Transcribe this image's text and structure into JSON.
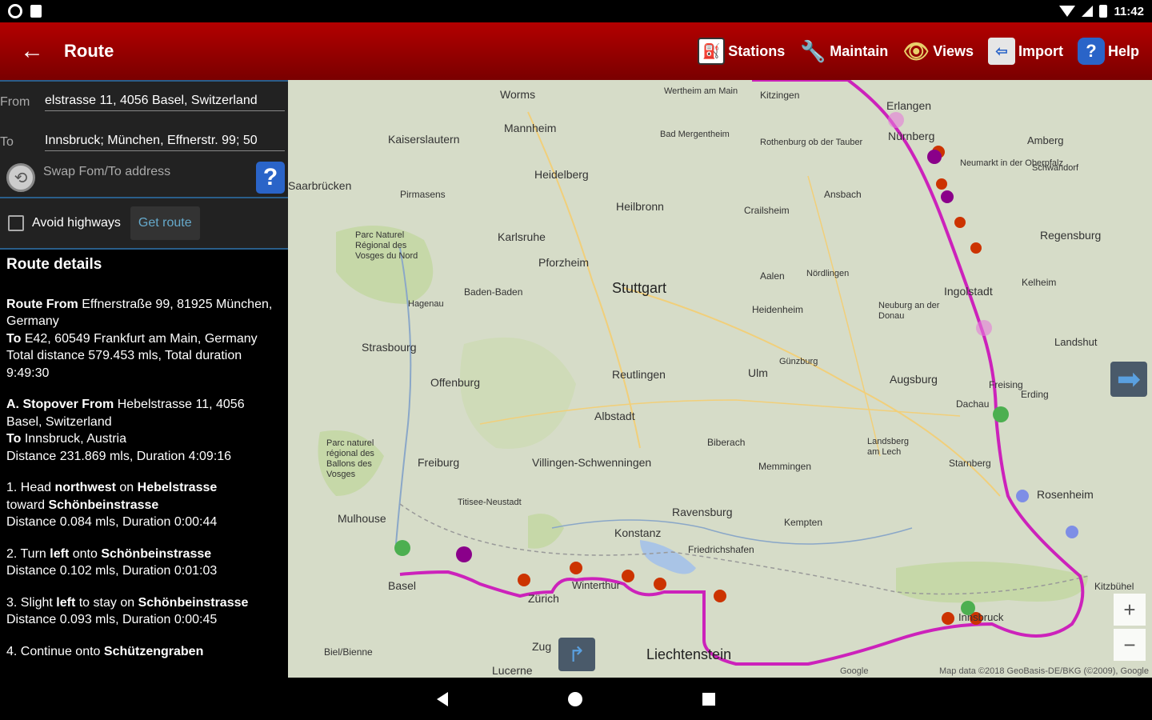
{
  "status": {
    "time": "11:42"
  },
  "actionbar": {
    "title": "Route",
    "actions": [
      {
        "label": "Stations",
        "icon": "fuel-pump-icon"
      },
      {
        "label": "Maintain",
        "icon": "wrench-icon"
      },
      {
        "label": "Views",
        "icon": "eye-icon"
      },
      {
        "label": "Import",
        "icon": "import-icon"
      },
      {
        "label": "Help",
        "icon": "help-icon"
      }
    ]
  },
  "form": {
    "from_label": "From",
    "from_value": "elstrasse 11, 4056 Basel, Switzerland",
    "to_label": "To",
    "to_value": "Innsbruck; München, Effnerstr. 99; 50",
    "swap_label": "Swap Fom/To address",
    "avoid_highways_label": "Avoid highways",
    "avoid_highways_checked": false,
    "get_route_label": "Get route"
  },
  "details": {
    "heading": "Route details",
    "summary": {
      "route_from_label": "Route From",
      "route_from": "Effnerstraße 99, 81925 München, Germany",
      "to_label": "To",
      "to": "E42, 60549 Frankfurt am Main, Germany",
      "totals": "Total distance 579.453 mls, Total duration 9:49:30"
    },
    "stopover": {
      "label": "A. Stopover From",
      "from": "Hebelstrasse 11, 4056 Basel, Switzerland",
      "to_label": "To",
      "to": "Innsbruck, Austria",
      "totals": "Distance 231.869 mls, Duration 4:09:16"
    },
    "steps": [
      {
        "n": "1.",
        "pre": "Head",
        "b1": "northwest",
        "mid": "on",
        "b2": "Hebelstrasse",
        "post": "toward",
        "b3": "Schönbeinstrasse",
        "dist": "Distance 0.084 mls, Duration 0:00:44"
      },
      {
        "n": "2.",
        "pre": "Turn",
        "b1": "left",
        "mid": "onto",
        "b2": "Schönbeinstrasse",
        "post": "",
        "b3": "",
        "dist": "Distance 0.102 mls, Duration 0:01:03"
      },
      {
        "n": "3.",
        "pre": "Slight",
        "b1": "left",
        "mid": "to stay on",
        "b2": "Schönbeinstrasse",
        "post": "",
        "b3": "",
        "dist": "Distance 0.093 mls, Duration 0:00:45"
      },
      {
        "n": "4.",
        "pre": "Continue onto",
        "b1": "Schützengraben",
        "mid": "",
        "b2": "",
        "post": "",
        "b3": "",
        "dist": ""
      }
    ]
  },
  "map": {
    "cities": [
      "Worms",
      "Mannheim",
      "Kaiserslautern",
      "Heidelberg",
      "Wertheim am Main",
      "Kitzingen",
      "Erlangen",
      "Nürnberg",
      "Amberg",
      "Bad Mergentheim",
      "Rothenburg ob der Tauber",
      "Neumarkt in der Oberpfalz",
      "Schwandorf",
      "Saarbrücken",
      "Pirmasens",
      "Heilbronn",
      "Crailsheim",
      "Ansbach",
      "Karlsruhe",
      "Pforzheim",
      "Parc Naturel Régional des Vosges du Nord",
      "Regensburg",
      "Stuttgart",
      "Baden-Baden",
      "Aalen",
      "Nördlingen",
      "Ingolstadt",
      "Kelheim",
      "Hagenau",
      "Heidenheim",
      "Neuburg an der Donau",
      "Strasbourg",
      "Landshut",
      "Reutlingen",
      "Ulm",
      "Günzburg",
      "Augsburg",
      "Freising",
      "Erding",
      "Offenburg",
      "Albstadt",
      "Dachau",
      "Biberach",
      "Landsberg am Lech",
      "Starnberg",
      "Freiburg",
      "Villingen-Schwenningen",
      "Memmingen",
      "Rosenheim",
      "Ravensburg",
      "Kempten",
      "Mulhouse",
      "Konstanz",
      "Friedrichshafen",
      "Basel",
      "Zürich",
      "Liechtenstein",
      "Zug",
      "Lucerne",
      "Biel/Bienne",
      "Kitzbühel",
      "Winterthur",
      "Innsbruck",
      "Titisee-Neustadt",
      "Parc naturel régional des Ballons des Vosges"
    ],
    "attribution": "Map data ©2018 GeoBasis-DE/BKG (©2009), Google",
    "google": "Google",
    "route_color": "#cc22bb"
  }
}
